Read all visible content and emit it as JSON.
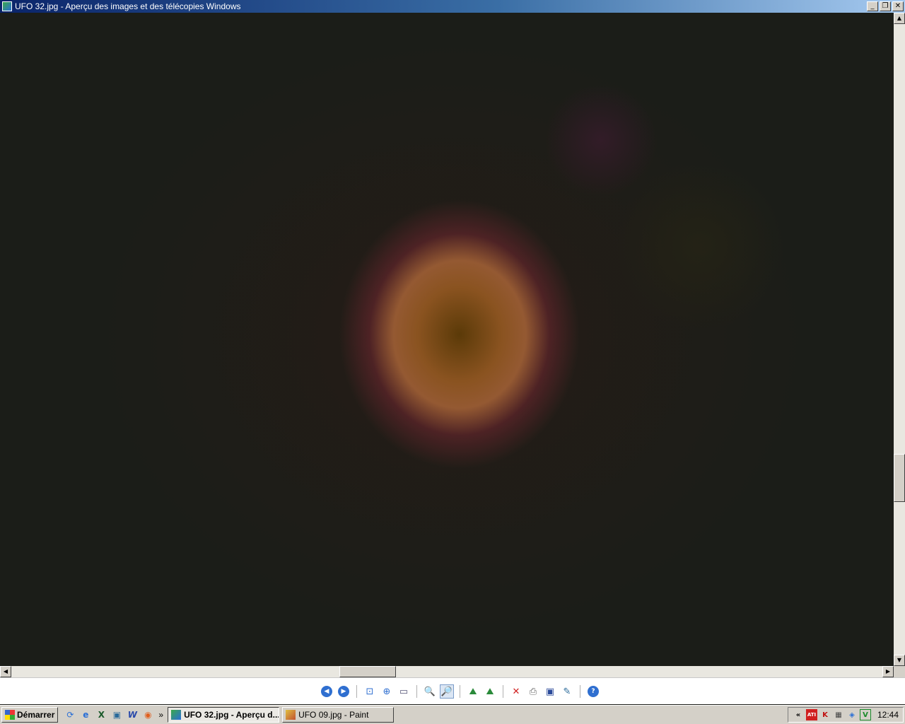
{
  "window": {
    "title": "UFO 32.jpg - Aperçu des images et des télécopies Windows",
    "minimize": "_",
    "restore": "❐",
    "close": "✕"
  },
  "scrollbars": {
    "up": "▲",
    "down": "▼",
    "left": "◀",
    "right": "▶"
  },
  "toolbar": {
    "icons": [
      "previous-image-icon",
      "next-image-icon",
      "best-fit-icon",
      "actual-size-icon",
      "slideshow-icon",
      "zoom-in-icon",
      "zoom-out-icon",
      "rotate-clockwise-icon",
      "rotate-counterclockwise-icon",
      "delete-icon",
      "print-icon",
      "save-icon",
      "open-editor-icon",
      "help-icon"
    ],
    "glyphs": {
      "prev": "◀",
      "next": "▶",
      "best_fit": "⊡",
      "actual_size": "⊕",
      "slideshow": "▭",
      "zoom_in": "🔍",
      "zoom_out": "🔎",
      "rotate_cw": "⛰",
      "rotate_ccw": "⛰",
      "delete": "✕",
      "print": "⎙",
      "save": "▣",
      "editor": "✎",
      "help": "?"
    },
    "accent": "#2f6fd0"
  },
  "taskbar": {
    "start_label": "Démarrer",
    "overflow": "»",
    "tasks": [
      {
        "label": "UFO 32.jpg - Aperçu d...",
        "active": true
      },
      {
        "label": "UFO 09.jpg - Paint",
        "active": false
      }
    ],
    "tray_overflow": "«",
    "tray_icons": [
      "ati-icon",
      "k-icon",
      "network-icon",
      "security-icon",
      "v-icon"
    ],
    "tray_glyphs": {
      "ati": "ATI",
      "k": "K",
      "net": "▦",
      "sec": "◈",
      "v": "V"
    },
    "clock": "12:44"
  }
}
